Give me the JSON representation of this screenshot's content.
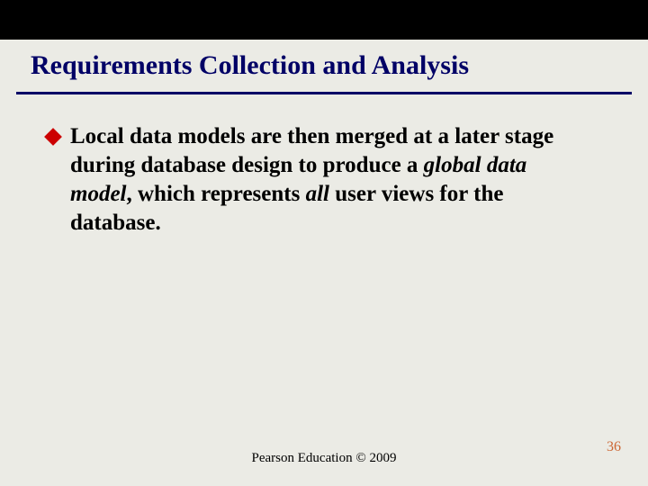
{
  "title": "Requirements Collection and Analysis",
  "bullet": {
    "p1": "Local data models are then merged at a later stage during database design to produce a ",
    "i1": "global data model",
    "p2": ", which represents ",
    "i2": "all",
    "p3": " user views for the database."
  },
  "footer": "Pearson Education © 2009",
  "page": "36",
  "colors": {
    "accent": "#000066",
    "bullet": "#cc0000",
    "pagenum": "#cc6633"
  }
}
